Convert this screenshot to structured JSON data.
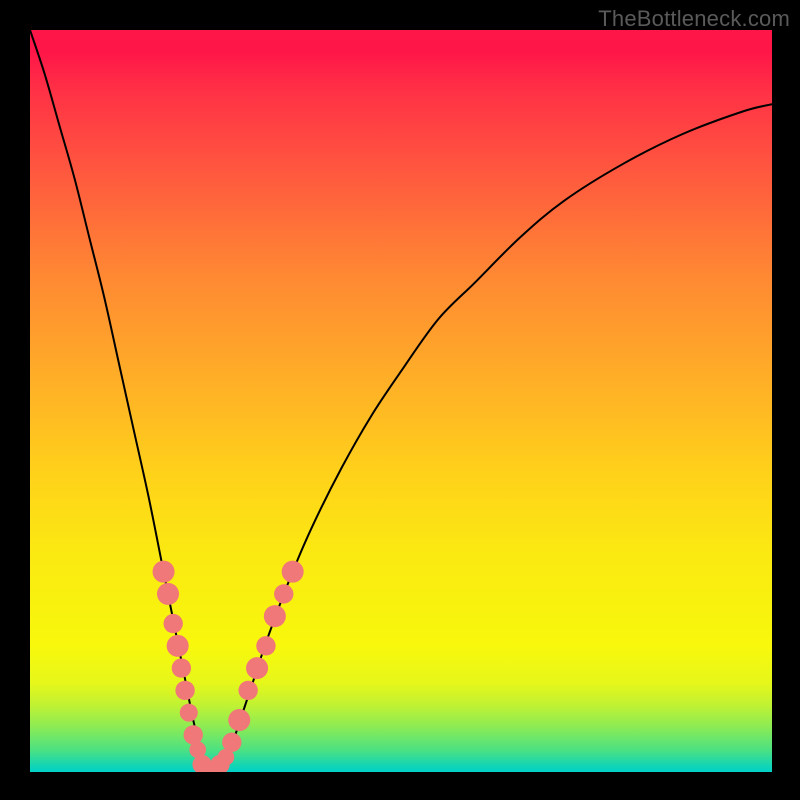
{
  "watermark": "TheBottleneck.com",
  "chart_data": {
    "type": "line",
    "title": "",
    "xlabel": "",
    "ylabel": "",
    "xlim": [
      0,
      100
    ],
    "ylim": [
      0,
      100
    ],
    "series": [
      {
        "name": "bottleneck-curve",
        "x": [
          0,
          2,
          4,
          6,
          8,
          10,
          12,
          14,
          16,
          18,
          20,
          21,
          22,
          23,
          24,
          25,
          26,
          27,
          28,
          30,
          32,
          35,
          38,
          42,
          46,
          50,
          55,
          60,
          66,
          72,
          80,
          88,
          96,
          100
        ],
        "y": [
          100,
          94,
          87,
          80,
          72,
          64,
          55,
          46,
          37,
          27,
          17,
          12,
          7,
          3,
          1,
          0,
          1,
          3,
          6,
          12,
          18,
          26,
          33,
          41,
          48,
          54,
          61,
          66,
          72,
          77,
          82,
          86,
          89,
          90
        ]
      }
    ],
    "markers": {
      "name": "highlight-dots",
      "color": "#f07878",
      "points": [
        {
          "x": 18.0,
          "y": 27,
          "r": 1.2
        },
        {
          "x": 18.6,
          "y": 24,
          "r": 1.2
        },
        {
          "x": 19.3,
          "y": 20,
          "r": 1.0
        },
        {
          "x": 19.9,
          "y": 17,
          "r": 1.2
        },
        {
          "x": 20.4,
          "y": 14,
          "r": 1.0
        },
        {
          "x": 20.9,
          "y": 11,
          "r": 1.0
        },
        {
          "x": 21.4,
          "y": 8,
          "r": 0.9
        },
        {
          "x": 22.0,
          "y": 5,
          "r": 1.0
        },
        {
          "x": 22.6,
          "y": 3,
          "r": 0.8
        },
        {
          "x": 23.2,
          "y": 1,
          "r": 1.0
        },
        {
          "x": 24.0,
          "y": 0,
          "r": 1.0
        },
        {
          "x": 24.8,
          "y": 0,
          "r": 0.8
        },
        {
          "x": 25.6,
          "y": 1,
          "r": 1.0
        },
        {
          "x": 26.4,
          "y": 2,
          "r": 0.8
        },
        {
          "x": 27.2,
          "y": 4,
          "r": 1.0
        },
        {
          "x": 28.2,
          "y": 7,
          "r": 1.2
        },
        {
          "x": 29.4,
          "y": 11,
          "r": 1.0
        },
        {
          "x": 30.6,
          "y": 14,
          "r": 1.2
        },
        {
          "x": 31.8,
          "y": 17,
          "r": 1.0
        },
        {
          "x": 33.0,
          "y": 21,
          "r": 1.2
        },
        {
          "x": 34.2,
          "y": 24,
          "r": 1.0
        },
        {
          "x": 35.4,
          "y": 27,
          "r": 1.2
        }
      ]
    }
  },
  "colors": {
    "curve": "#000000",
    "marker": "#f07878",
    "frame": "#000000"
  }
}
